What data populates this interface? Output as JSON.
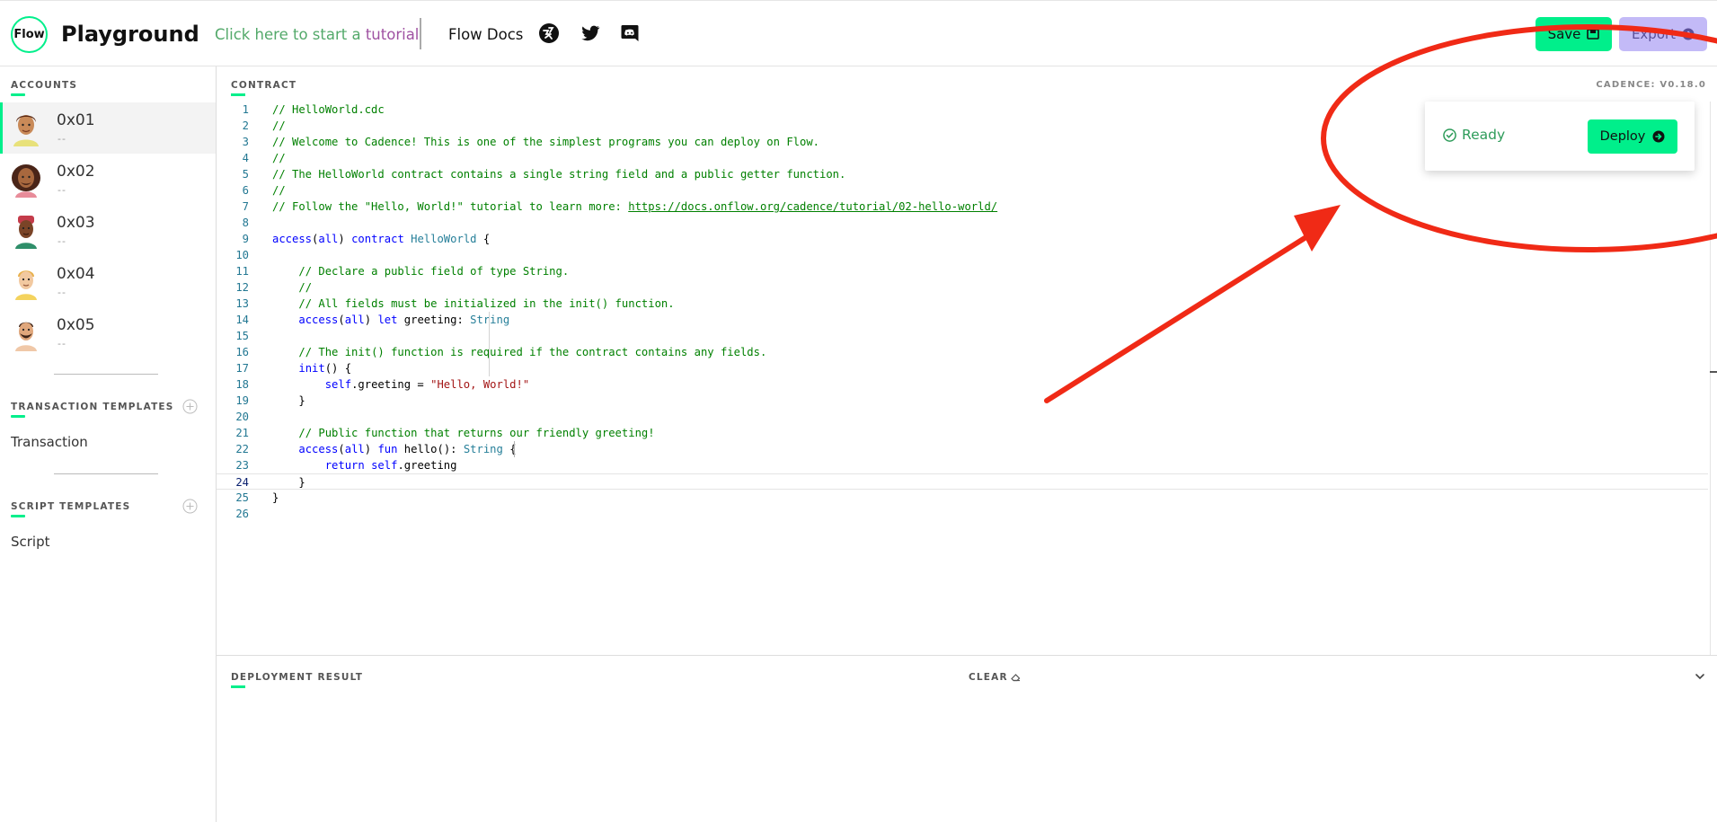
{
  "header": {
    "logo_text": "Flow",
    "title": "Playground",
    "tutorial_part1": "Click here to start a ",
    "tutorial_part2": "tutorial",
    "docs_link": "Flow Docs",
    "icons": [
      "flow-run-icon",
      "twitter-icon",
      "discord-icon"
    ],
    "save_label": "Save",
    "export_label": "Export"
  },
  "sidebar": {
    "accounts_label": "ACCOUNTS",
    "accounts": [
      {
        "address": "0x01",
        "sub": "--"
      },
      {
        "address": "0x02",
        "sub": "--"
      },
      {
        "address": "0x03",
        "sub": "--"
      },
      {
        "address": "0x04",
        "sub": "--"
      },
      {
        "address": "0x05",
        "sub": "--"
      }
    ],
    "transaction_templates_label": "TRANSACTION TEMPLATES",
    "transaction_item": "Transaction",
    "script_templates_label": "SCRIPT TEMPLATES",
    "script_item": "Script"
  },
  "editor": {
    "label": "CONTRACT",
    "version": "CADENCE: V0.18.0",
    "active_line": 24,
    "lines": [
      [
        {
          "t": "// HelloWorld.cdc",
          "c": "com"
        }
      ],
      [
        {
          "t": "//",
          "c": "com"
        }
      ],
      [
        {
          "t": "// Welcome to Cadence! This is one of the simplest programs you can deploy on Flow.",
          "c": "com"
        }
      ],
      [
        {
          "t": "//",
          "c": "com"
        }
      ],
      [
        {
          "t": "// The HelloWorld contract contains a single string field and a public getter function.",
          "c": "com"
        }
      ],
      [
        {
          "t": "//",
          "c": "com"
        }
      ],
      [
        {
          "t": "// Follow the \"Hello, World!\" tutorial to learn more: ",
          "c": "com"
        },
        {
          "t": "https://docs.onflow.org/cadence/tutorial/02-hello-world/",
          "c": "link"
        }
      ],
      [],
      [
        {
          "t": "access",
          "c": "kw"
        },
        {
          "t": "("
        },
        {
          "t": "all",
          "c": "kw"
        },
        {
          "t": ") "
        },
        {
          "t": "contract",
          "c": "kw"
        },
        {
          "t": " "
        },
        {
          "t": "HelloWorld",
          "c": "type"
        },
        {
          "t": " {"
        }
      ],
      [],
      [
        {
          "t": "    "
        },
        {
          "t": "// Declare a public field of type String.",
          "c": "com"
        }
      ],
      [
        {
          "t": "    "
        },
        {
          "t": "//",
          "c": "com"
        }
      ],
      [
        {
          "t": "    "
        },
        {
          "t": "// All fields must be initialized in the init() function.",
          "c": "com"
        }
      ],
      [
        {
          "t": "    "
        },
        {
          "t": "access",
          "c": "kw"
        },
        {
          "t": "("
        },
        {
          "t": "all",
          "c": "kw"
        },
        {
          "t": ") "
        },
        {
          "t": "let",
          "c": "kw"
        },
        {
          "t": " greeting: "
        },
        {
          "t": "String",
          "c": "type"
        }
      ],
      [],
      [
        {
          "t": "    "
        },
        {
          "t": "// The init() function is required if the contract contains any fields.",
          "c": "com"
        }
      ],
      [
        {
          "t": "    "
        },
        {
          "t": "init",
          "c": "kw"
        },
        {
          "t": "() {"
        }
      ],
      [
        {
          "t": "        "
        },
        {
          "t": "self",
          "c": "kw"
        },
        {
          "t": ".greeting = "
        },
        {
          "t": "\"Hello, World!\"",
          "c": "str"
        }
      ],
      [
        {
          "t": "    }"
        }
      ],
      [],
      [
        {
          "t": "    "
        },
        {
          "t": "// Public function that returns our friendly greeting!",
          "c": "com"
        }
      ],
      [
        {
          "t": "    "
        },
        {
          "t": "access",
          "c": "kw"
        },
        {
          "t": "("
        },
        {
          "t": "all",
          "c": "kw"
        },
        {
          "t": ") "
        },
        {
          "t": "fun",
          "c": "kw"
        },
        {
          "t": " hello(): "
        },
        {
          "t": "String",
          "c": "type"
        },
        {
          "t": " {"
        }
      ],
      [
        {
          "t": "        "
        },
        {
          "t": "return",
          "c": "kw"
        },
        {
          "t": " "
        },
        {
          "t": "self",
          "c": "kw"
        },
        {
          "t": ".greeting"
        }
      ],
      [
        {
          "t": "    }"
        }
      ],
      [
        {
          "t": "}"
        }
      ],
      []
    ]
  },
  "deploy": {
    "status": "Ready",
    "button_label": "Deploy"
  },
  "result": {
    "label": "DEPLOYMENT RESULT",
    "clear_label": "CLEAR"
  },
  "colors": {
    "accent": "#00ef8b",
    "export_bg": "#c3baf7",
    "annotation": "#f02a16"
  }
}
